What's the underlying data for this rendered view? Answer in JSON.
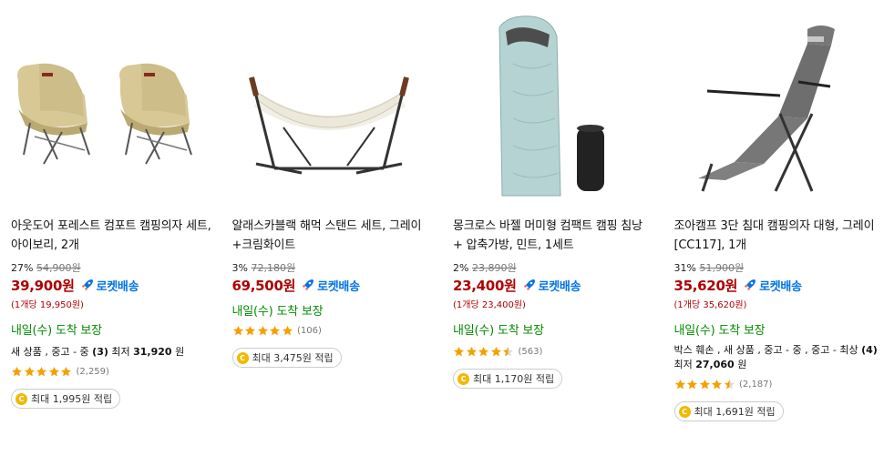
{
  "products": [
    {
      "title": "아웃도어 포레스트 컴포트 캠핑의자 세트, 아이보리, 2개",
      "discount": "27%",
      "original_price": "54,900원",
      "price": "39,900원",
      "rocket_label": "로켓배송",
      "unit_price": "(1개당 19,950원)",
      "arrival": "내일(수) 도착 보장",
      "used_text_prefix": "새 상품 , 중고 - 중 ",
      "used_count": "(3)",
      "used_text_mid": " 최저 ",
      "used_price": "31,920",
      "used_text_suffix": " 원",
      "rating": 5,
      "review_count": "(2,259)",
      "reward": "최대 1,995원 적립"
    },
    {
      "title": "알래스카블랙 해먹 스탠드 세트, 그레이+크림화이트",
      "discount": "3%",
      "original_price": "72,180원",
      "price": "69,500원",
      "rocket_label": "로켓배송",
      "unit_price": "",
      "arrival": "내일(수) 도착 보장",
      "rating": 5,
      "review_count": "(106)",
      "reward": "최대 3,475원 적립"
    },
    {
      "title": "몽크로스 바젤 머미형 컴팩트 캠핑 침낭 + 압축가방, 민트, 1세트",
      "discount": "2%",
      "original_price": "23,890원",
      "price": "23,400원",
      "rocket_label": "로켓배송",
      "unit_price": "(1개당 23,400원)",
      "arrival": "내일(수) 도착 보장",
      "rating": 4.5,
      "review_count": "(563)",
      "reward": "최대 1,170원 적립"
    },
    {
      "title": "조아캠프 3단 침대 캠핑의자 대형, 그레이[CC117], 1개",
      "discount": "31%",
      "original_price": "51,900원",
      "price": "35,620원",
      "rocket_label": "로켓배송",
      "unit_price": "(1개당 35,620원)",
      "arrival": "내일(수) 도착 보장",
      "used_text_prefix": "박스 훼손 , 새 상품 , 중고 - 중 , 중고 - 최상 ",
      "used_count": "(4)",
      "used_text_mid": " 최저 ",
      "used_price": "27,060",
      "used_text_suffix": " 원",
      "rating": 4.5,
      "review_count": "(2,187)",
      "reward": "최대 1,691원 적립"
    }
  ],
  "colors": {
    "price": "#ae0000",
    "rocket": "#0073e9",
    "arrival": "#008c00",
    "star": "#f5a000",
    "coin": "#f3b800"
  },
  "icons": {
    "rocket": "rocket-icon",
    "star": "star-icon",
    "coin": "coin-icon"
  }
}
